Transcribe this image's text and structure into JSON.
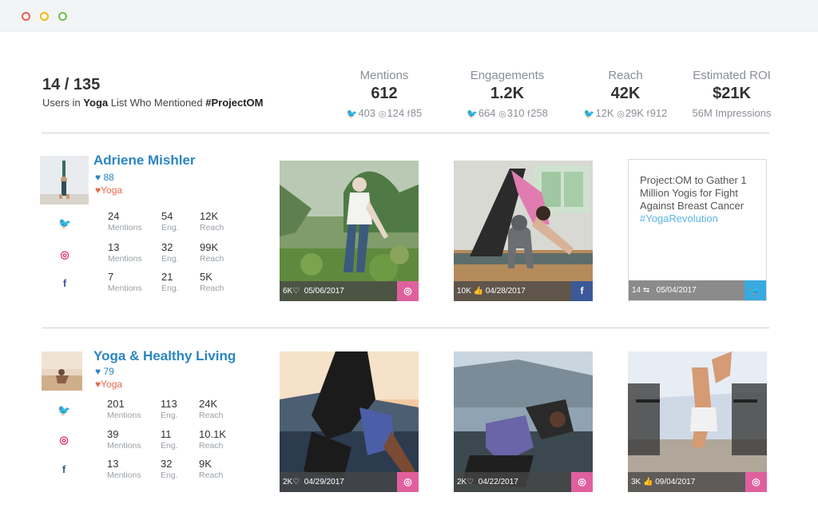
{
  "summary": {
    "count": "14 / 135",
    "sub_prefix": "Users in ",
    "list_name": "Yoga",
    "sub_middle": " List Who Mentioned ",
    "hashtag": "#ProjectOM"
  },
  "stats": [
    {
      "label": "Mentions",
      "value": "612",
      "tw": "403",
      "ig": "124",
      "fb": "85"
    },
    {
      "label": "Engagements",
      "value": "1.2K",
      "tw": "664",
      "ig": "310",
      "fb": "258"
    },
    {
      "label": "Reach",
      "value": "42K",
      "tw": "12K",
      "ig": "29K",
      "fb": "912"
    },
    {
      "label": "Estimated ROI",
      "value": "$21K",
      "detail": "56M Impressions"
    }
  ],
  "influencers": [
    {
      "name": "Adriene Mishler",
      "score": "88",
      "list": "Yoga",
      "rows": [
        {
          "mentions": "24",
          "eng": "54",
          "reach": "12K"
        },
        {
          "mentions": "13",
          "eng": "32",
          "reach": "99K"
        },
        {
          "mentions": "7",
          "eng": "21",
          "reach": "5K"
        }
      ],
      "posts": [
        {
          "likes": "6K",
          "date": "05/06/2017",
          "network": "instagram"
        },
        {
          "likes": "10K",
          "date": "04/28/2017",
          "network": "facebook"
        },
        {
          "text": "Project:OM to Gather 1 Million Yogis for Fight Against Breast Cancer",
          "hashtag": "#YogaRevolution",
          "likes": "14",
          "date": "05/04/2017",
          "network": "twitter"
        }
      ]
    },
    {
      "name": "Yoga & Healthy Living",
      "score": "79",
      "list": "Yoga",
      "rows": [
        {
          "mentions": "201",
          "eng": "113",
          "reach": "24K"
        },
        {
          "mentions": "39",
          "eng": "11",
          "reach": "10.1K"
        },
        {
          "mentions": "13",
          "eng": "32",
          "reach": "9K"
        }
      ],
      "posts": [
        {
          "likes": "2K",
          "date": "04/29/2017",
          "network": "instagram"
        },
        {
          "likes": "2K",
          "date": "04/22/2017",
          "network": "instagram"
        },
        {
          "likes": "3K",
          "date": "09/04/2017",
          "network": "instagram"
        }
      ]
    }
  ],
  "captions": {
    "mentions": "Mentions",
    "eng": "Eng.",
    "reach": "Reach"
  },
  "icons": {
    "twitter": "twitter-icon",
    "instagram": "instagram-icon",
    "facebook": "facebook-icon",
    "heart": "heart-icon"
  },
  "colors": {
    "accent": "#2a86c1",
    "orange": "#e8694a",
    "instagram": "#e0609e",
    "facebook": "#3b5998",
    "twitter": "#39a9e0"
  }
}
